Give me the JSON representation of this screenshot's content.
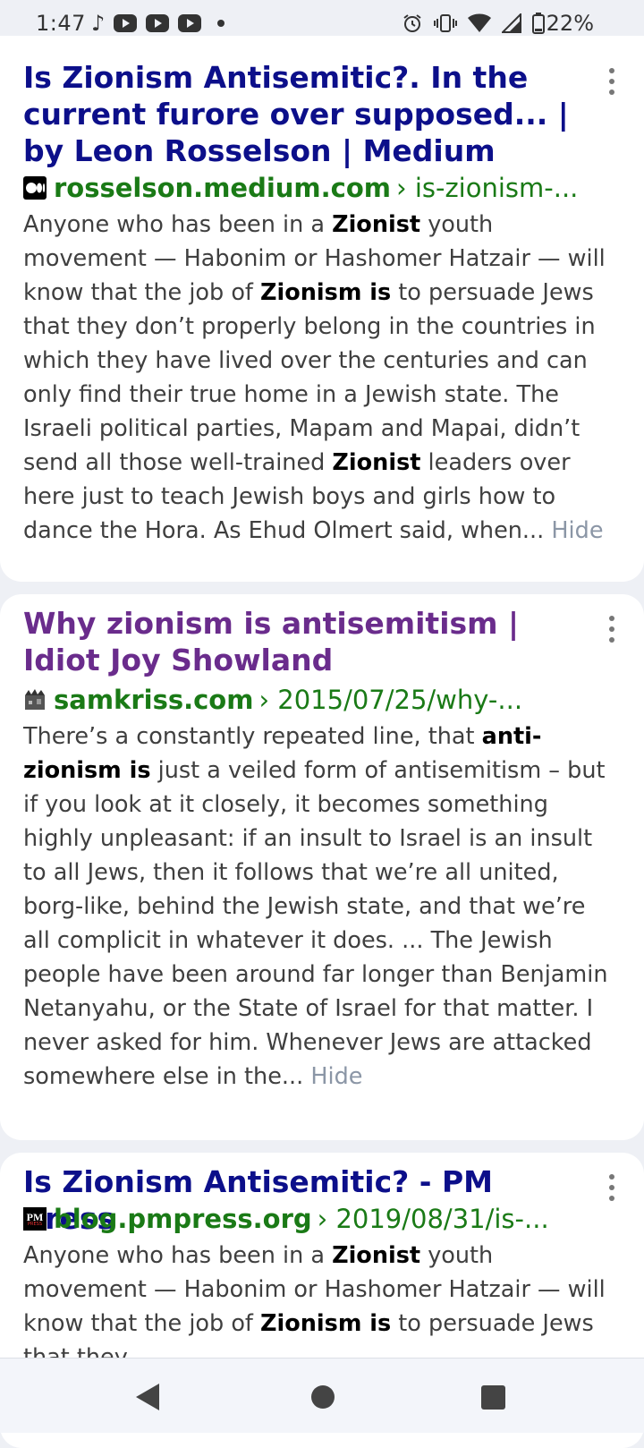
{
  "status_bar": {
    "time": "1:47",
    "left_icons": [
      "tiktok-icon",
      "youtube-icon",
      "youtube-icon",
      "youtube-icon",
      "dot-icon"
    ],
    "right_icons": [
      "alarm-icon",
      "vibrate-icon",
      "wifi-icon",
      "signal-icon",
      "battery-icon"
    ],
    "battery": "22%"
  },
  "results": [
    {
      "title": "Is Zionism Antisemitic?. In the current furore over supposed... | by Leon Rosselson | Medium",
      "title_color": "#0c0f8a",
      "favicon": "medium-icon",
      "domain": "rosselson.medium.com",
      "path": "› is-zionism-...",
      "snippet_parts": [
        "Anyone who has been in a ",
        "Zionist",
        " youth movement — Habonim or Hashomer Hatzair — will know that the job of ",
        "Zionism is",
        " to persuade Jews that they don’t properly belong in the countries in which they have lived over the centuries and can only find their true home in a Jewish state. The Israeli political parties, Mapam and Mapai, didn’t send all those well-trained ",
        "Zionist",
        " leaders over here just to teach Jewish boys and girls how to dance the Hora. As Ehud Olmert said, when..."
      ],
      "hide_label": "Hide"
    },
    {
      "title": "Why zionism is antisemitism | Idiot Joy Showland",
      "title_color": "#6a2c8c",
      "favicon": "samkriss-icon",
      "domain": "samkriss.com",
      "path": "› 2015/07/25/why-...",
      "snippet_parts": [
        "There’s a constantly repeated line, that ",
        "anti-zionism is",
        " just a veiled form of antisemitism – but if you look at it closely, it becomes something highly unpleasant: if an insult to Israel is an insult to all Jews, then it follows that we’re all united, borg-like, behind the Jewish state, and that we’re all complicit in whatever it does. ... The Jewish people have been around far longer than Benjamin Netanyahu, or the State of Israel for that matter. I never asked for him. Whenever Jews are attacked somewhere else in the..."
      ],
      "hide_label": "Hide"
    },
    {
      "title": "Is Zionism Antisemitic? - PM Press",
      "title_color": "#0c0f8a",
      "favicon": "pm-press-icon",
      "favicon_text": "PM",
      "favicon_subtext": "PRESS",
      "domain": "blog.pmpress.org",
      "path": "› 2019/08/31/is-...",
      "snippet_parts": [
        "Anyone who has been in a ",
        "Zionist",
        " youth movement — Habonim or Hashomer Hatzair — will know that the job of ",
        "Zionism is",
        " to persuade Jews that they"
      ]
    }
  ],
  "nav_bar": {
    "icons": [
      "back-icon",
      "home-icon",
      "recents-icon"
    ]
  }
}
